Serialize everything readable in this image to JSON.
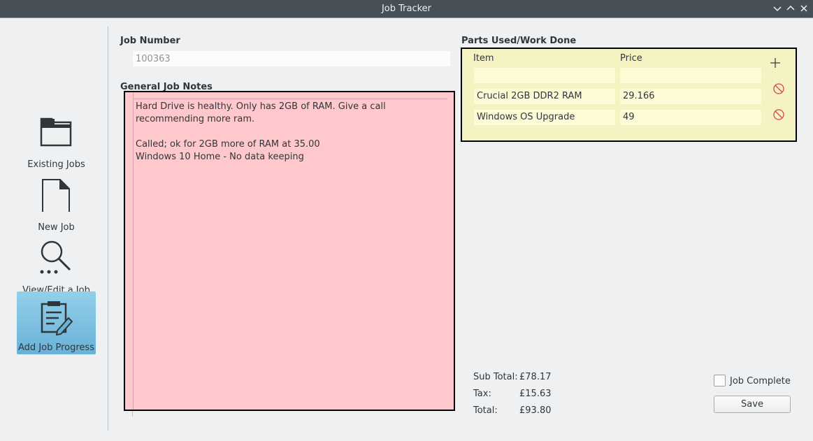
{
  "window": {
    "title": "Job Tracker"
  },
  "sidebar": {
    "items": [
      {
        "label": "Existing Jobs",
        "icon": "folder-icon",
        "active": false
      },
      {
        "label": "New Job",
        "icon": "document-icon",
        "active": false
      },
      {
        "label": "View/Edit a Job",
        "icon": "search-icon",
        "active": false
      },
      {
        "label": "Add Job Progress",
        "icon": "edit-list-icon",
        "active": true
      }
    ]
  },
  "job": {
    "number_label": "Job Number",
    "number_value": "100363",
    "notes_label": "General Job Notes",
    "notes_text": "Hard Drive is healthy. Only has 2GB of RAM. Give a call recommending more ram.\n\nCalled; ok for 2GB more of RAM at 35.00\nWindows 10 Home - No data keeping"
  },
  "parts": {
    "label": "Parts Used/Work Done",
    "col_item": "Item",
    "col_price": "Price",
    "new_row": {
      "item": "",
      "price": ""
    },
    "rows": [
      {
        "item": "Crucial 2GB DDR2 RAM",
        "price": "29.166"
      },
      {
        "item": "Windows OS Upgrade",
        "price": "49"
      }
    ]
  },
  "totals": {
    "subtotal_label": "Sub Total:",
    "subtotal_value": "£78.17",
    "tax_label": "Tax:",
    "tax_value": "£15.63",
    "total_label": "Total:",
    "total_value": "£93.80"
  },
  "footer": {
    "complete_label": "Job Complete",
    "save_label": "Save"
  },
  "colors": {
    "notes_bg": "#fec8cc",
    "parts_bg": "#f5f3c2",
    "active_nav": "#69b2d8",
    "titlebar": "#475057"
  }
}
